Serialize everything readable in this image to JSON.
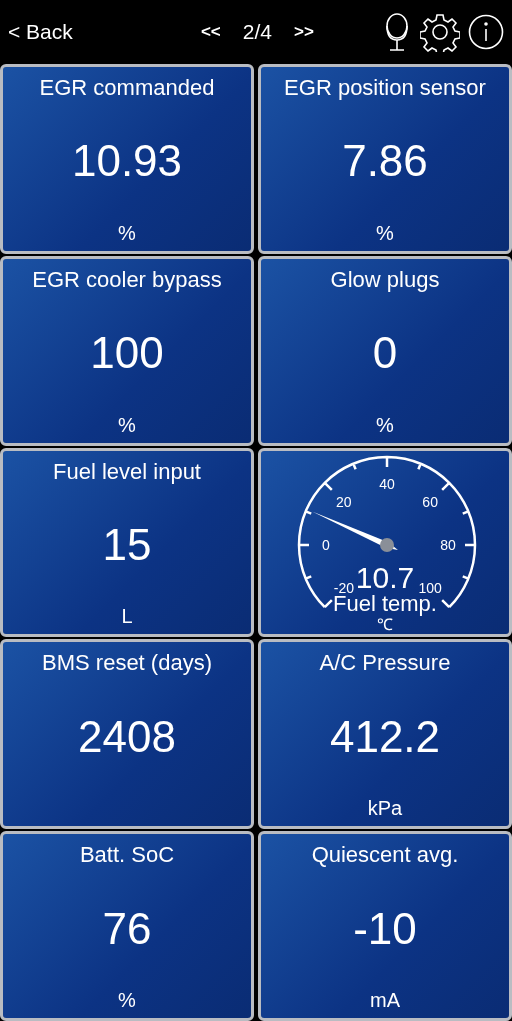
{
  "header": {
    "back": "< Back",
    "prev": "<<",
    "page": "2/4",
    "next": ">>"
  },
  "tiles": [
    {
      "kind": "digital",
      "title": "EGR commanded",
      "value": "10.93",
      "unit": "%"
    },
    {
      "kind": "digital",
      "title": "EGR position sensor",
      "value": "7.86",
      "unit": "%"
    },
    {
      "kind": "digital",
      "title": "EGR cooler bypass",
      "value": "100",
      "unit": "%"
    },
    {
      "kind": "digital",
      "title": "Glow plugs",
      "value": "0",
      "unit": "%"
    },
    {
      "kind": "digital",
      "title": "Fuel level input",
      "value": "15",
      "unit": "L"
    },
    {
      "kind": "gauge",
      "title": "Fuel temp.",
      "value": "10.7",
      "unit": "℃",
      "ticks": [
        "-20",
        "0",
        "20",
        "40",
        "60",
        "80",
        "100"
      ]
    },
    {
      "kind": "digital",
      "title": "BMS reset (days)",
      "value": "2408"
    },
    {
      "kind": "digital",
      "title": "A/C Pressure",
      "value": "412.2",
      "unit": "kPa"
    },
    {
      "kind": "digital",
      "title": "Batt. SoC",
      "value": "76",
      "unit": "%"
    },
    {
      "kind": "digital",
      "title": "Quiescent avg.",
      "value": "-10",
      "unit": "mA"
    }
  ]
}
